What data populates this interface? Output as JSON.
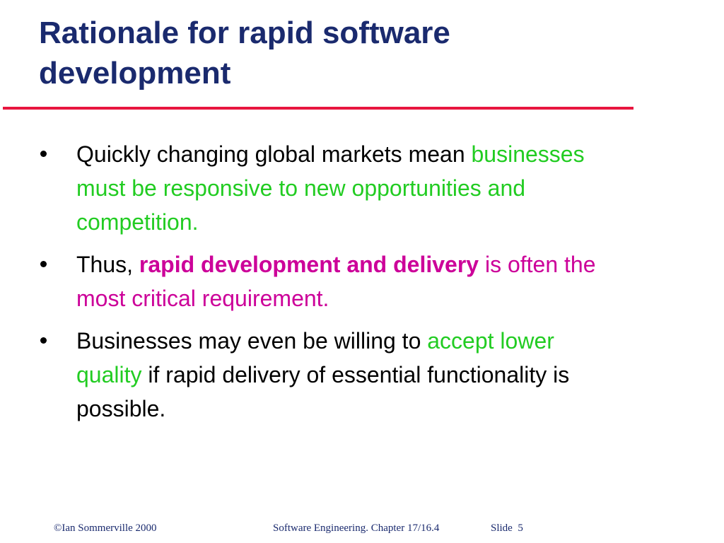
{
  "slide": {
    "title_line1": "Rationale for rapid software",
    "title_line2": "development",
    "accent_color": "#e8163f",
    "title_color": "#1a2a6e",
    "highlight_green": "#22cc22",
    "highlight_magenta": "#cc0099"
  },
  "bullets": [
    {
      "seg1": "Quickly changing global markets mean ",
      "seg2": "businesses must be responsive to new opportunities and competition."
    },
    {
      "seg1": "Thus, ",
      "seg2": "rapid development and delivery",
      "seg3": " is often the most critical requirement."
    },
    {
      "seg1": "Businesses may even be willing to ",
      "seg2": "accept lower quality",
      "seg3": " if rapid delivery of essential functionality is possible."
    }
  ],
  "footer": {
    "copyright": "©Ian Sommerville 2000",
    "chapter": "Software Engineering. Chapter 17/16.4",
    "slide_label": "Slide",
    "slide_number": "5"
  }
}
